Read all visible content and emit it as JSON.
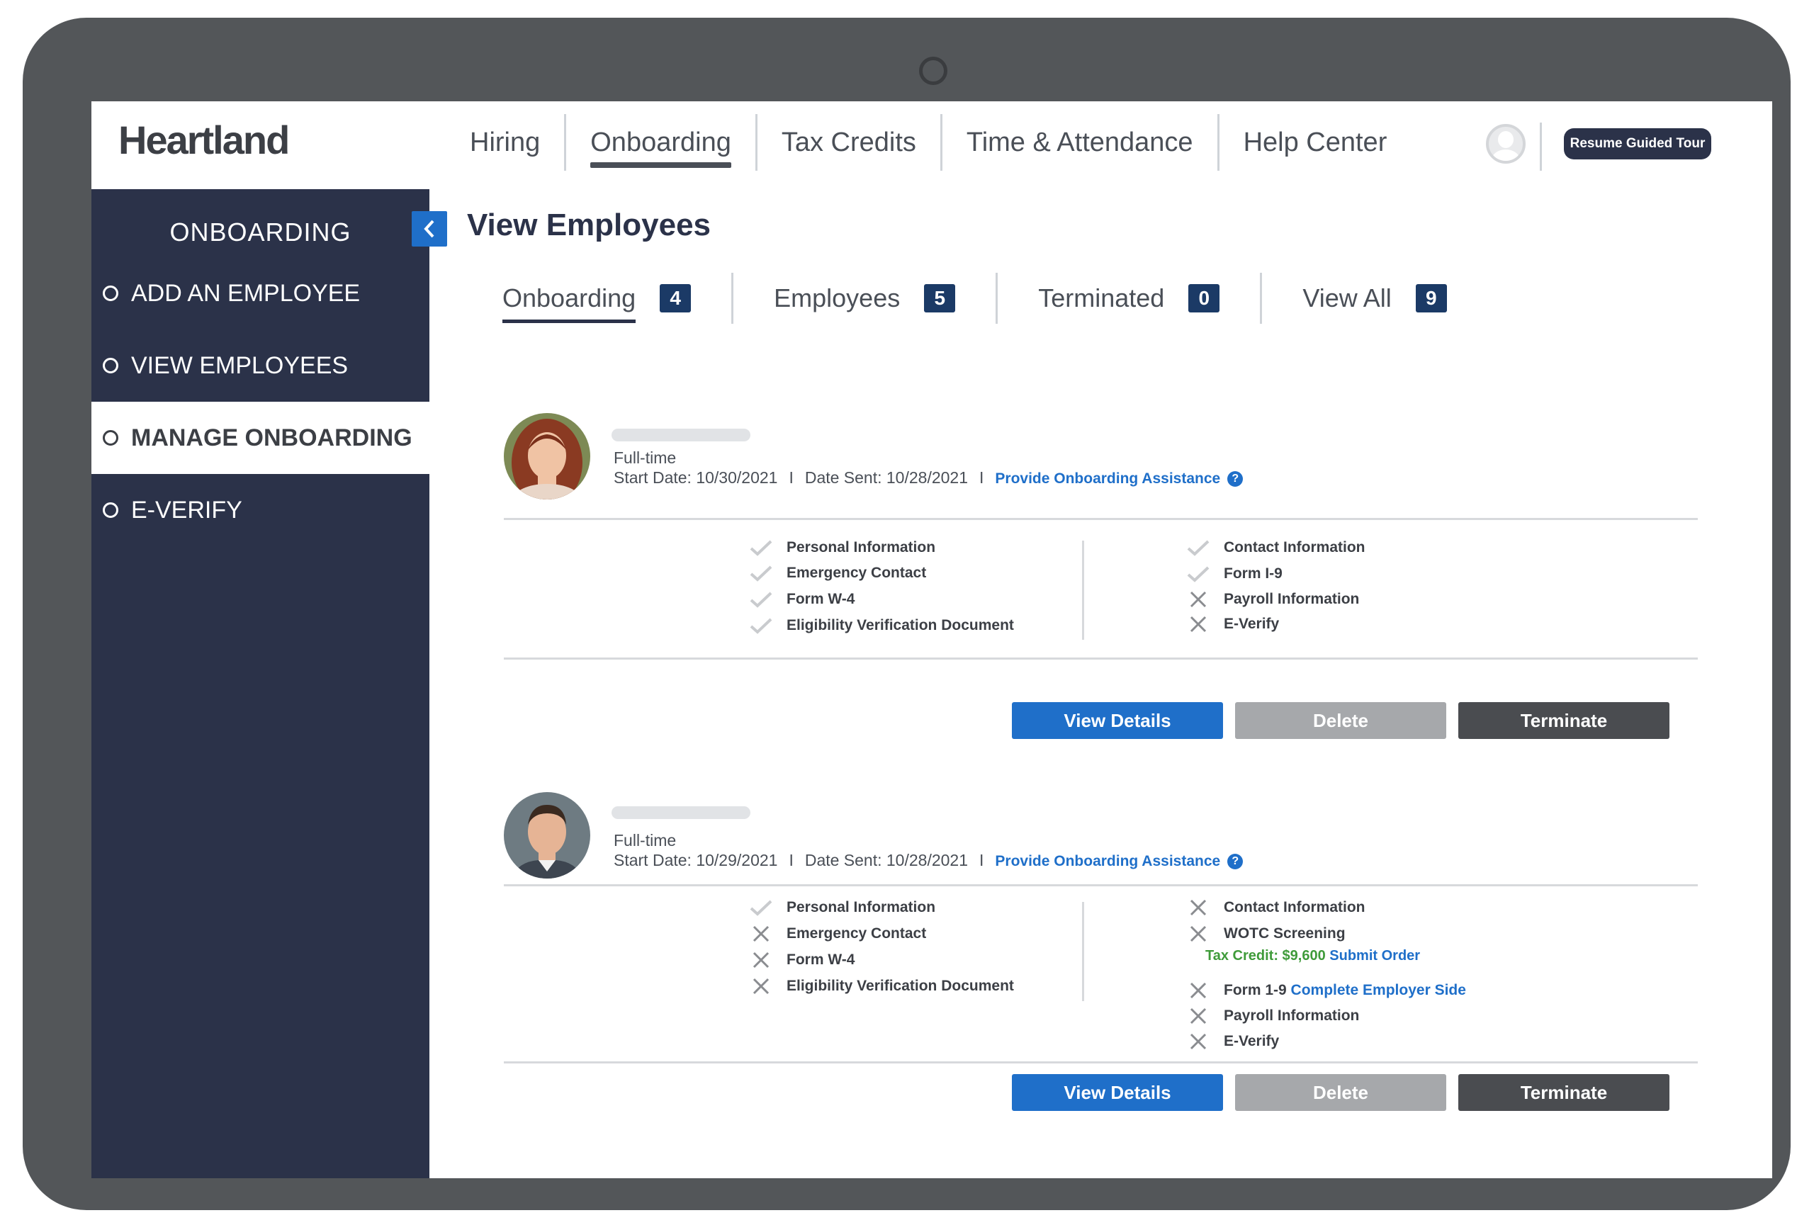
{
  "app": {
    "logo": "Heartland",
    "tour_button": "Resume Guided Tour"
  },
  "nav": [
    {
      "label": "Hiring",
      "active": false
    },
    {
      "label": "Onboarding",
      "active": true
    },
    {
      "label": "Tax Credits",
      "active": false
    },
    {
      "label": "Time & Attendance",
      "active": false
    },
    {
      "label": "Help Center",
      "active": false
    }
  ],
  "sidebar": {
    "title": "ONBOARDING",
    "items": [
      {
        "label": "ADD AN EMPLOYEE",
        "active": false
      },
      {
        "label": "VIEW EMPLOYEES",
        "active": false
      },
      {
        "label": "MANAGE ONBOARDING",
        "active": true
      },
      {
        "label": "E-VERIFY",
        "active": false
      }
    ]
  },
  "page_title": "View Employees",
  "tabs": [
    {
      "label": "Onboarding",
      "count": "4",
      "active": true
    },
    {
      "label": "Employees",
      "count": "5",
      "active": false
    },
    {
      "label": "Terminated",
      "count": "0",
      "active": false
    },
    {
      "label": "View All",
      "count": "9",
      "active": false
    }
  ],
  "employees": [
    {
      "type": "Full-time",
      "start_date": "Start Date: 10/30/2021",
      "separator": "I",
      "date_sent": "Date Sent: 10/28/2021",
      "assist_link": "Provide Onboarding Assistance",
      "left_items": [
        {
          "label": "Personal Information",
          "status": "complete"
        },
        {
          "label": "Emergency Contact",
          "status": "complete"
        },
        {
          "label": "Form W-4",
          "status": "complete"
        },
        {
          "label": "Eligibility Verification Document",
          "status": "complete"
        }
      ],
      "right_items": [
        {
          "label": "Contact Information",
          "status": "complete"
        },
        {
          "label": "Form I-9",
          "status": "complete"
        },
        {
          "label": "Payroll Information",
          "status": "incomplete"
        },
        {
          "label": "E-Verify",
          "status": "incomplete"
        }
      ],
      "buttons": {
        "view": "View Details",
        "delete": "Delete",
        "terminate": "Terminate"
      }
    },
    {
      "type": "Full-time",
      "start_date": "Start Date: 10/29/2021",
      "separator": "I",
      "date_sent": "Date Sent: 10/28/2021",
      "assist_link": "Provide Onboarding Assistance",
      "left_items": [
        {
          "label": "Personal Information",
          "status": "complete"
        },
        {
          "label": "Emergency Contact",
          "status": "incomplete"
        },
        {
          "label": "Form W-4",
          "status": "incomplete"
        },
        {
          "label": "Eligibility Verification Document",
          "status": "incomplete"
        }
      ],
      "right_items": [
        {
          "label": "Contact Information",
          "status": "incomplete"
        },
        {
          "label": "WOTC Screening",
          "status": "incomplete"
        },
        {
          "label": "Form 1-9",
          "status": "incomplete",
          "link": "Complete Employer Side"
        },
        {
          "label": "Payroll Information",
          "status": "incomplete"
        },
        {
          "label": "E-Verify",
          "status": "incomplete"
        }
      ],
      "tax_credit": {
        "text": "Tax Credit: $9,600",
        "link": "Submit Order"
      },
      "buttons": {
        "view": "View Details",
        "delete": "Delete",
        "terminate": "Terminate"
      }
    }
  ],
  "colors": {
    "sidebar": "#2b3249",
    "accent": "#1f6fc9",
    "badge": "#1b3a66",
    "success": "#3f9b3a"
  },
  "icons": {
    "complete": "check-icon",
    "incomplete": "x-icon"
  }
}
